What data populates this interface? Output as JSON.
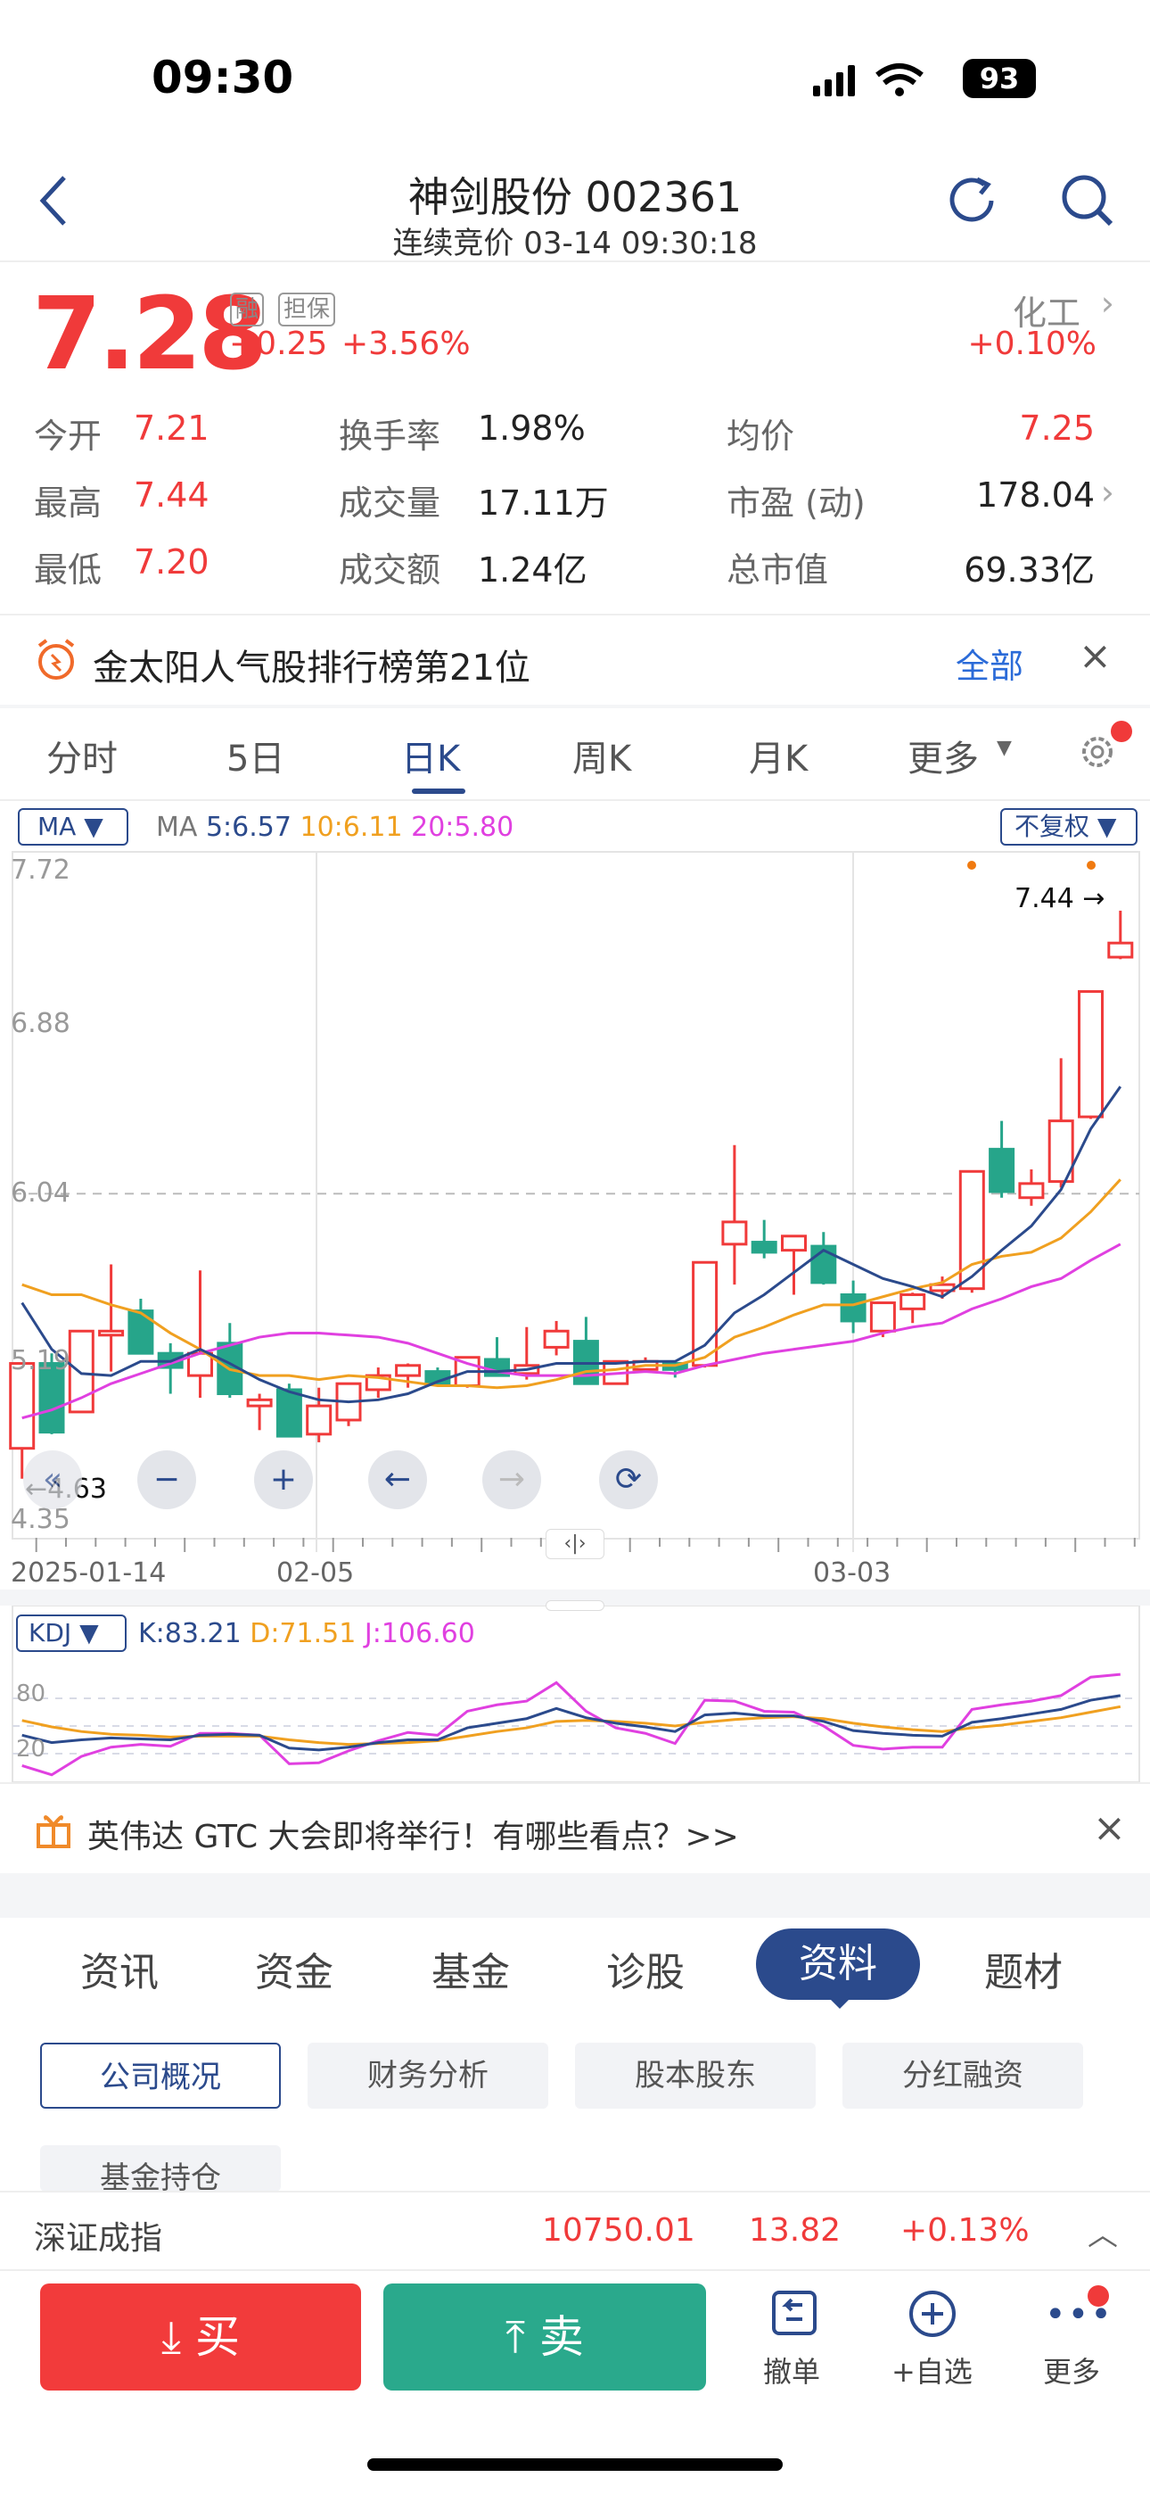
{
  "status_bar": {
    "time": "09:30",
    "battery": "93"
  },
  "header": {
    "title": "神剑股份 002361",
    "subtitle": "连续竞价 03-14 09:30:18"
  },
  "quote": {
    "price": "7.28",
    "badge1": "融",
    "badge2": "担保",
    "change": "+0.25",
    "change_pct": "+3.56%",
    "sector": "化工",
    "sector_pct": "+0.10%",
    "stats": [
      {
        "label": "今开",
        "value": "7.21"
      },
      {
        "label": "换手率",
        "value": "1.98%"
      },
      {
        "label": "均价",
        "value": "7.25"
      },
      {
        "label": "最高",
        "value": "7.44"
      },
      {
        "label": "成交量",
        "value": "17.11万"
      },
      {
        "label": "市盈 (动)",
        "value": "178.04"
      },
      {
        "label": "最低",
        "value": "7.20"
      },
      {
        "label": "成交额",
        "value": "1.24亿"
      },
      {
        "label": "总市值",
        "value": "69.33亿"
      }
    ]
  },
  "rank_banner": {
    "text": "金太阳人气股排行榜第21位",
    "link": "全部"
  },
  "chart_tabs": [
    "分时",
    "5日",
    "日K",
    "周K",
    "月K",
    "更多"
  ],
  "ma": {
    "selector": "MA",
    "prefix": "MA",
    "ma5": "5:6.57",
    "ma10": "10:6.11",
    "ma20": "20:5.80",
    "adjust": "不复权"
  },
  "kdj": {
    "selector": "KDJ",
    "k": "K:83.21",
    "d": "D:71.51",
    "j": "J:106.60",
    "ticks": [
      "80",
      "20"
    ]
  },
  "colors": {
    "up": "#f03a3a",
    "down": "#26a58a",
    "ma5": "#2b4a8c",
    "ma10": "#f0a020",
    "ma20": "#e040e0"
  },
  "chart_data": {
    "type": "candlestick",
    "y_ticks": [
      "7.72",
      "6.88",
      "6.04",
      "5.19",
      "4.35"
    ],
    "ylim": [
      4.35,
      7.72
    ],
    "x_labels": [
      "2025-01-14",
      "02-05",
      "03-03"
    ],
    "max_label": "7.44",
    "min_label": "4.63",
    "ohlc": [
      [
        4.78,
        5.2,
        4.63,
        5.2
      ],
      [
        5.2,
        5.25,
        4.85,
        4.86
      ],
      [
        4.96,
        5.36,
        4.96,
        5.36
      ],
      [
        5.34,
        5.69,
        5.16,
        5.36
      ],
      [
        5.46,
        5.52,
        5.25,
        5.25
      ],
      [
        5.25,
        5.3,
        5.05,
        5.18
      ],
      [
        5.14,
        5.66,
        5.03,
        5.25
      ],
      [
        5.3,
        5.4,
        5.03,
        5.05
      ],
      [
        4.99,
        5.05,
        4.87,
        5.02
      ],
      [
        5.07,
        5.1,
        4.84,
        4.84
      ],
      [
        4.85,
        5.08,
        4.81,
        4.99
      ],
      [
        4.92,
        5.1,
        4.89,
        5.1
      ],
      [
        5.07,
        5.18,
        5.03,
        5.14
      ],
      [
        5.14,
        5.2,
        5.08,
        5.19
      ],
      [
        5.16,
        5.18,
        5.1,
        5.1
      ],
      [
        5.09,
        5.23,
        5.08,
        5.23
      ],
      [
        5.22,
        5.33,
        5.14,
        5.14
      ],
      [
        5.15,
        5.38,
        5.12,
        5.19
      ],
      [
        5.28,
        5.41,
        5.24,
        5.36
      ],
      [
        5.31,
        5.43,
        5.1,
        5.1
      ],
      [
        5.1,
        5.21,
        5.1,
        5.21
      ],
      [
        5.17,
        5.23,
        5.16,
        5.21
      ],
      [
        5.2,
        5.21,
        5.13,
        5.17
      ],
      [
        5.19,
        5.7,
        5.18,
        5.7
      ],
      [
        5.79,
        6.28,
        5.59,
        5.9
      ],
      [
        5.8,
        5.91,
        5.72,
        5.75
      ],
      [
        5.76,
        5.83,
        5.54,
        5.83
      ],
      [
        5.78,
        5.85,
        5.59,
        5.6
      ],
      [
        5.54,
        5.61,
        5.35,
        5.41
      ],
      [
        5.36,
        5.5,
        5.33,
        5.5
      ],
      [
        5.47,
        5.55,
        5.4,
        5.54
      ],
      [
        5.56,
        5.63,
        5.52,
        5.59
      ],
      [
        5.57,
        6.15,
        5.55,
        6.15
      ],
      [
        6.26,
        6.4,
        6.02,
        6.05
      ],
      [
        6.02,
        6.16,
        5.98,
        6.09
      ],
      [
        6.1,
        6.71,
        6.07,
        6.4
      ],
      [
        6.42,
        7.04,
        6.41,
        7.04
      ],
      [
        7.21,
        7.44,
        7.2,
        7.28
      ]
    ],
    "ma5": [
      5.5,
      5.27,
      5.15,
      5.14,
      5.21,
      5.21,
      5.27,
      5.2,
      5.12,
      5.06,
      5.02,
      5.01,
      5.02,
      5.05,
      5.11,
      5.16,
      5.16,
      5.17,
      5.2,
      5.2,
      5.2,
      5.21,
      5.21,
      5.29,
      5.45,
      5.54,
      5.65,
      5.76,
      5.69,
      5.62,
      5.58,
      5.53,
      5.63,
      5.76,
      5.88,
      6.06,
      6.36,
      6.57
    ],
    "ma10": [
      5.59,
      5.54,
      5.54,
      5.49,
      5.45,
      5.35,
      5.27,
      5.17,
      5.14,
      5.14,
      5.12,
      5.14,
      5.13,
      5.11,
      5.09,
      5.09,
      5.08,
      5.09,
      5.12,
      5.16,
      5.17,
      5.19,
      5.19,
      5.23,
      5.33,
      5.38,
      5.44,
      5.49,
      5.49,
      5.53,
      5.57,
      5.6,
      5.69,
      5.73,
      5.75,
      5.82,
      5.95,
      6.11
    ],
    "ma20": [
      4.93,
      4.97,
      5.03,
      5.1,
      5.15,
      5.2,
      5.25,
      5.29,
      5.33,
      5.35,
      5.35,
      5.34,
      5.33,
      5.3,
      5.25,
      5.2,
      5.16,
      5.14,
      5.14,
      5.14,
      5.15,
      5.16,
      5.15,
      5.19,
      5.22,
      5.25,
      5.27,
      5.29,
      5.31,
      5.35,
      5.38,
      5.4,
      5.47,
      5.52,
      5.58,
      5.62,
      5.71,
      5.79
    ],
    "kdj_k": [
      40,
      32,
      35,
      37,
      36,
      35,
      40,
      41,
      40,
      26,
      24,
      27,
      32,
      35,
      35,
      48,
      53,
      58,
      69,
      59,
      53,
      49,
      44,
      62,
      64,
      61,
      61,
      55,
      45,
      42,
      40,
      39,
      54,
      58,
      63,
      68,
      78,
      83
    ],
    "kdj_d": [
      56,
      49,
      44,
      41,
      40,
      38,
      39,
      39,
      39,
      35,
      32,
      30,
      31,
      32,
      34,
      39,
      44,
      48,
      55,
      56,
      55,
      53,
      50,
      54,
      57,
      59,
      60,
      58,
      53,
      49,
      46,
      44,
      48,
      51,
      55,
      59,
      65,
      71
    ],
    "kdj_j": [
      7,
      -3,
      17,
      27,
      30,
      28,
      42,
      42,
      40,
      9,
      10,
      23,
      34,
      43,
      40,
      66,
      73,
      77,
      97,
      66,
      48,
      42,
      31,
      78,
      77,
      66,
      65,
      50,
      29,
      25,
      27,
      27,
      68,
      73,
      77,
      83,
      103,
      106
    ]
  },
  "news_banner": {
    "text": "英伟达 GTC 大会即将举行！有哪些看点？>>"
  },
  "section_tabs": [
    "资讯",
    "资金",
    "基金",
    "诊股",
    "资料",
    "题材"
  ],
  "sub_tabs": [
    "公司概况",
    "财务分析",
    "股本股东",
    "分红融资",
    "基金持仓"
  ],
  "index_bar": {
    "name": "深证成指",
    "value": "10750.01",
    "change": "13.82",
    "pct": "+0.13%"
  },
  "bottom": {
    "buy": "买",
    "sell": "卖",
    "cancel": "撤单",
    "watch": "+自选",
    "more": "更多"
  }
}
